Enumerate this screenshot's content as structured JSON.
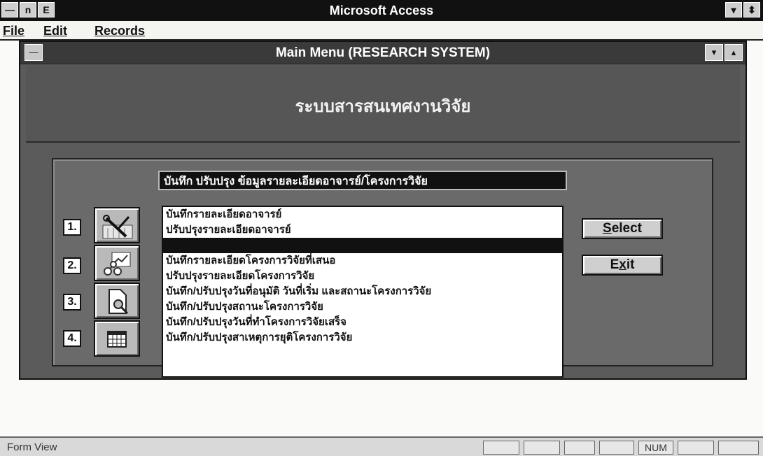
{
  "app": {
    "title": "Microsoft Access",
    "system_icons": [
      "minimize-system-icon",
      "app-icon-n",
      "app-icon-e"
    ]
  },
  "menu": {
    "items": [
      {
        "label": "File",
        "mnemonic": "F"
      },
      {
        "label": "Edit",
        "mnemonic": "E"
      },
      {
        "label": "Records",
        "mnemonic": "R"
      }
    ]
  },
  "window": {
    "title": "Main  Menu (RESEARCH SYSTEM)",
    "thai_title": "ระบบสารสนเทศงานวิจัย",
    "section_label": "บันทึก  ปรับปรุง ข้อมูลรายละเอียดอาจารย์/โครงการวิจัย"
  },
  "numbers": [
    "1.",
    "2.",
    "3.",
    "4."
  ],
  "icons": [
    "tools-icon",
    "network-diagram-icon",
    "report-search-icon",
    "calendar-icon"
  ],
  "list_items": [
    "บันทึกรายละเอียดอาจารย์",
    "ปรับปรุงรายละเอียดอาจารย์",
    "",
    "บันทึกรายละเอียดโครงการวิจัยที่เสนอ",
    "ปรับปรุงรายละเอียดโครงการวิจัย",
    "บันทึก/ปรับปรุงวันที่อนุมัติ วันที่เริ่ม และสถานะโครงการวิจัย",
    "บันทึก/ปรับปรุงสถานะโครงการวิจัย",
    "บันทึก/ปรับปรุงวันที่ทำโครงการวิจัยเสร็จ",
    "บันทึก/ปรับปรุงสาเหตุการยุติโครงการวิจัย"
  ],
  "buttons": {
    "select": {
      "before": "",
      "mnemonic": "S",
      "after": "elect"
    },
    "exit": {
      "before": "E",
      "mnemonic": "x",
      "after": "it"
    }
  },
  "status": {
    "text": "Form View",
    "indicator": "NUM"
  }
}
